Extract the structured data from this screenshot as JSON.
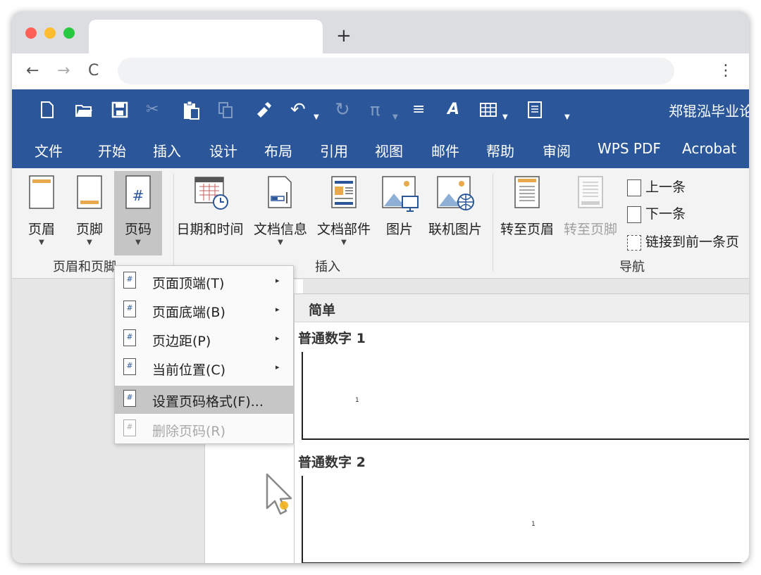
{
  "browser": {
    "new_tab": "+",
    "back": "←",
    "forward": "→",
    "reload": "C",
    "menu": "⋮"
  },
  "qat": {
    "icons": [
      "new-icon",
      "open-icon",
      "save-icon",
      "cut-icon",
      "paste-icon",
      "copy-icon",
      "format-painter-icon",
      "undo-icon",
      "redo-icon",
      "equation-icon",
      "align-icon",
      "font-icon",
      "table-icon",
      "page-icon",
      "customize-icon"
    ],
    "doc_title": "郑锟泓毕业论"
  },
  "menubar": {
    "items": [
      "文件",
      "开始",
      "插入",
      "设计",
      "布局",
      "引用",
      "视图",
      "邮件",
      "帮助",
      "审阅",
      "WPS PDF",
      "Acrobat"
    ]
  },
  "ribbon": {
    "header": "页眉",
    "footer": "页脚",
    "page_number": "页码",
    "page_number_glyph": "#",
    "date_time": "日期和时间",
    "doc_info": "文档信息",
    "doc_parts": "文档部件",
    "picture": "图片",
    "online_picture": "联机图片",
    "goto_header": "转至页眉",
    "goto_footer": "转至页脚",
    "previous": "上一条",
    "next": "下一条",
    "link_previous": "链接到前一条页",
    "group_header_footer": "页眉和页脚",
    "group_insert": "插入",
    "group_navigation": "导航"
  },
  "dropdown": {
    "items": [
      {
        "label": "页面顶端(T)",
        "submenu": true,
        "disabled": false,
        "highlighted": false
      },
      {
        "label": "页面底端(B)",
        "submenu": true,
        "disabled": false,
        "highlighted": false
      },
      {
        "label": "页边距(P)",
        "submenu": true,
        "disabled": false,
        "highlighted": false
      },
      {
        "label": "当前位置(C)",
        "submenu": true,
        "disabled": false,
        "highlighted": false
      },
      {
        "label": "设置页码格式(F)...",
        "submenu": false,
        "disabled": false,
        "highlighted": true
      },
      {
        "label": "删除页码(R)",
        "submenu": false,
        "disabled": true,
        "highlighted": false
      }
    ],
    "arrow": "▸"
  },
  "gallery": {
    "header": "简单",
    "items": [
      {
        "title": "普通数字 1",
        "number": "1"
      },
      {
        "title": "普通数字 2",
        "number": "1"
      }
    ]
  }
}
